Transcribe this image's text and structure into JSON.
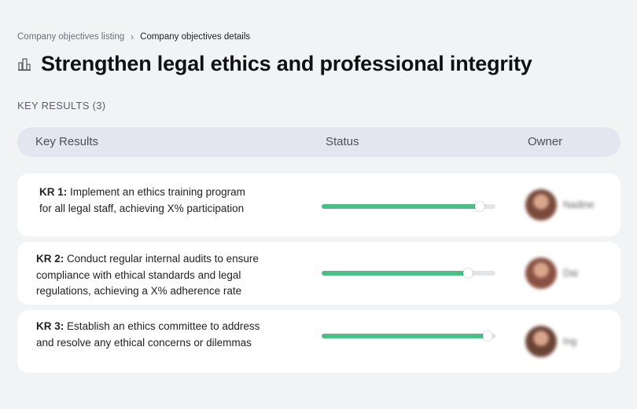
{
  "breadcrumb": {
    "parent": "Company objectives listing",
    "separator": "›",
    "current": "Company objectives details"
  },
  "title": "Strengthen legal ethics and professional integrity",
  "title_icon": "building-icon",
  "key_results_label": "KEY RESULTS (3)",
  "table": {
    "headers": {
      "key_results": "Key Results",
      "status": "Status",
      "owner": "Owner"
    }
  },
  "rows": [
    {
      "kr_label": "KR 1:",
      "text_1": "Implement an ethics training program",
      "text_2": "for all legal staff, achieving X% participation",
      "text_3": "",
      "progress": 0.91,
      "owner": "Nadine",
      "avatar_color": "#7a4a3c"
    },
    {
      "kr_label": "KR 2:",
      "text_1": "Conduct regular internal audits to ensure",
      "text_2": "compliance with ethical standards and legal",
      "text_3": "regulations, achieving a X% adherence rate",
      "progress": 0.84,
      "owner": "Dai",
      "avatar_color": "#8a5142"
    },
    {
      "kr_label": "KR 3:",
      "text_1": "Establish an ethics committee to address",
      "text_2": "and resolve any ethical concerns or dilemmas",
      "text_3": "",
      "progress": 0.955,
      "owner": "Ing",
      "avatar_color": "#6b4436"
    }
  ],
  "colors": {
    "progress": "#4cbf86",
    "header_bg": "#e3e6ef",
    "page_bg": "#f2f3f5"
  }
}
